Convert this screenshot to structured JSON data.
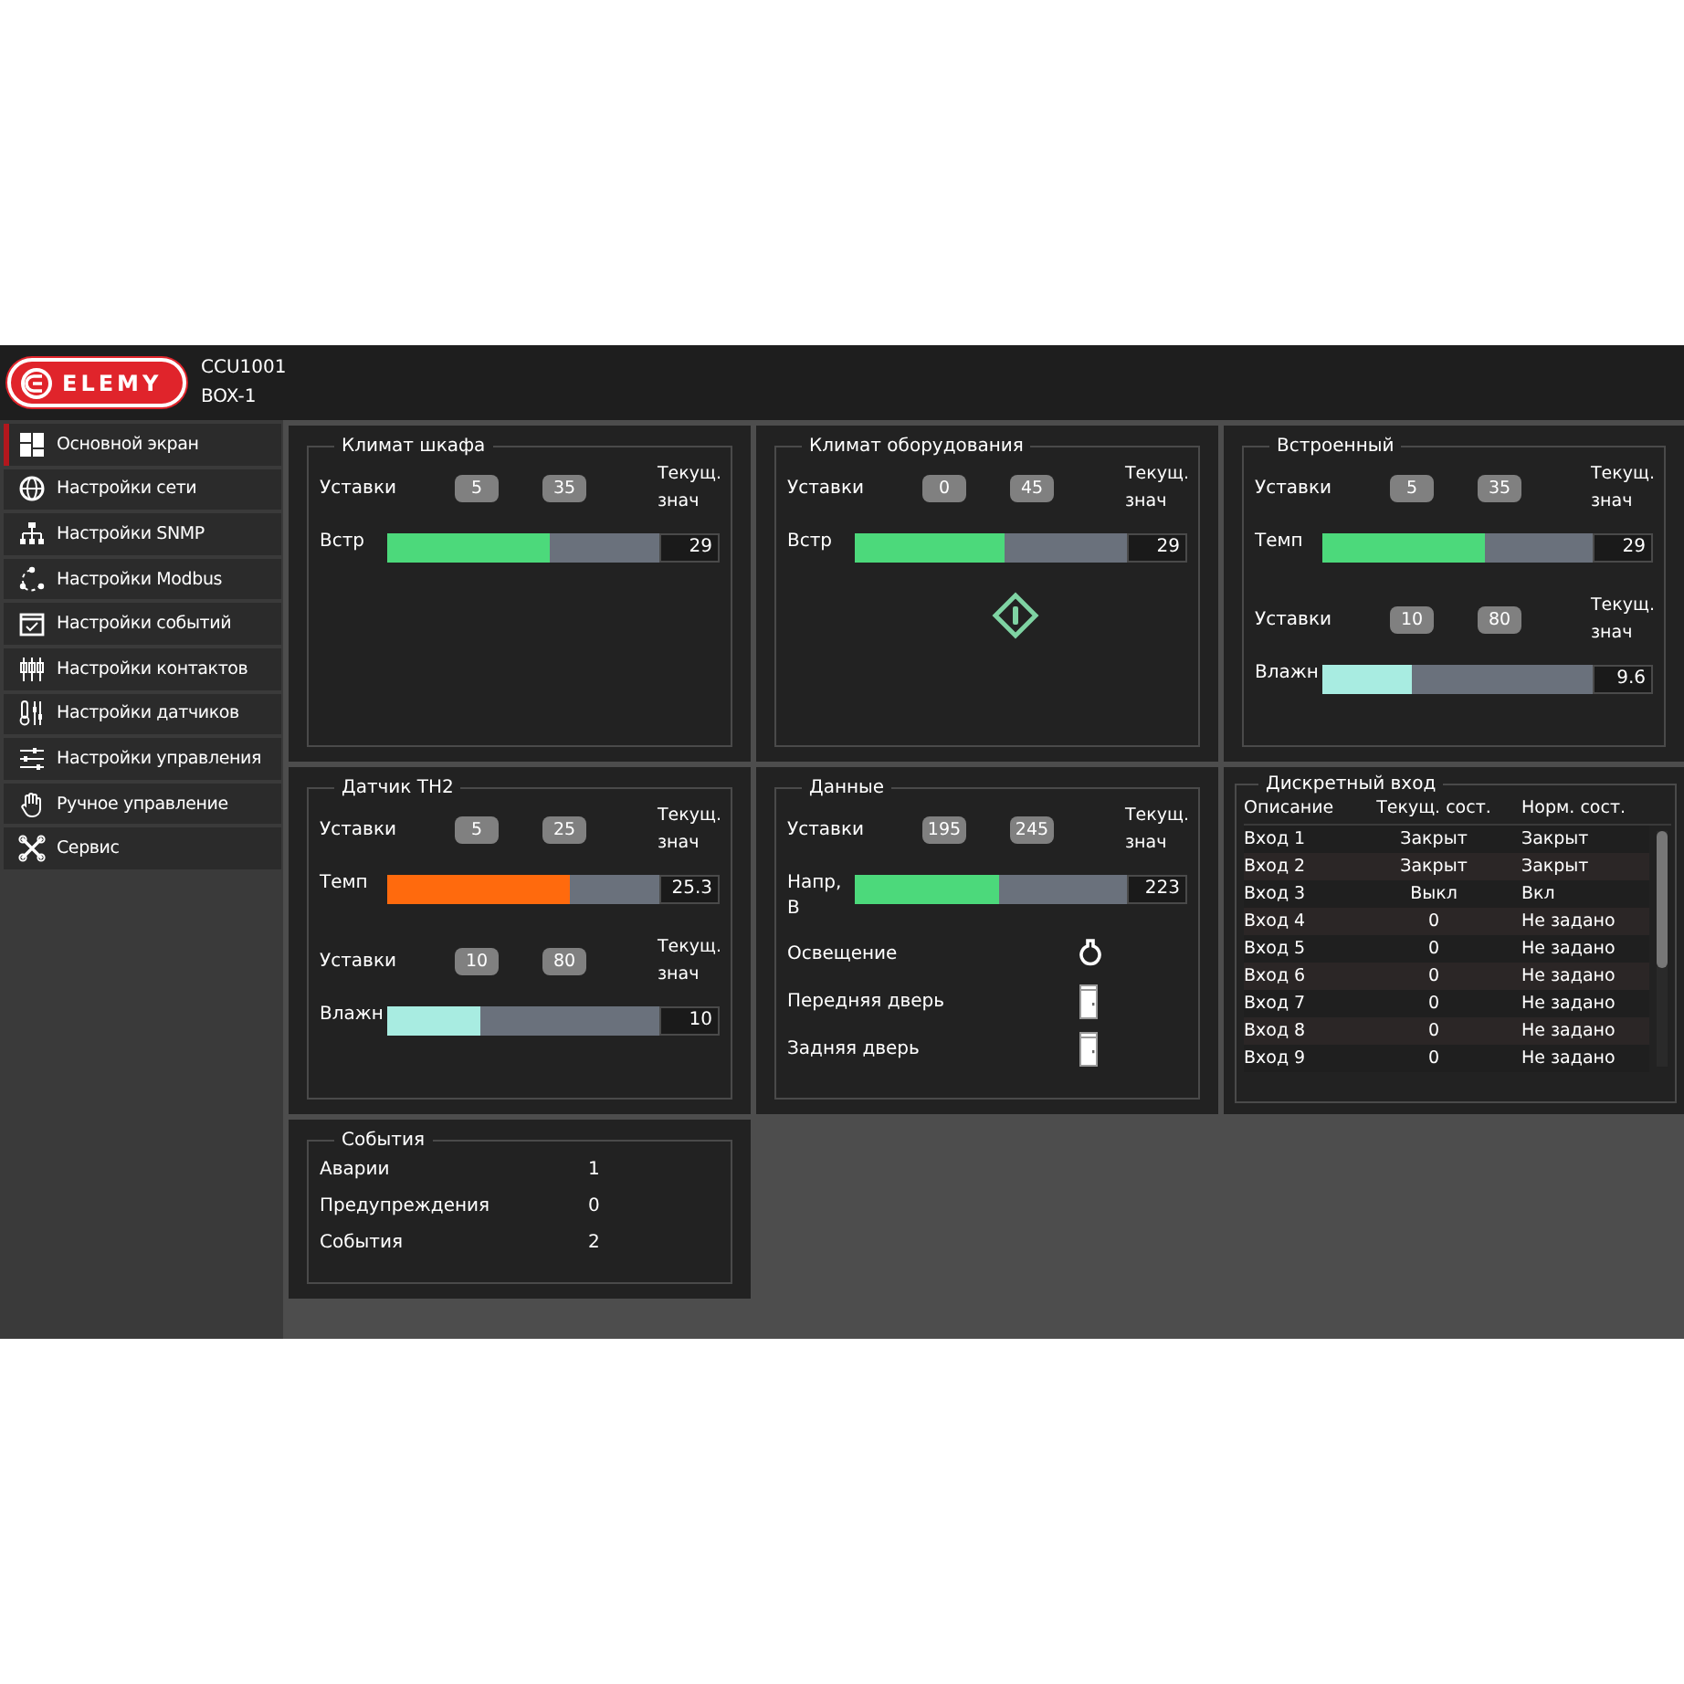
{
  "header": {
    "logo_text": "ELEMY",
    "device": "CCU1001",
    "box": "BOX-1"
  },
  "sidebar": {
    "items": [
      {
        "label": "Основной экран",
        "selected": true
      },
      {
        "label": "Настройки сети",
        "selected": false
      },
      {
        "label": "Настройки SNMP",
        "selected": false
      },
      {
        "label": "Настройки Modbus",
        "selected": false
      },
      {
        "label": "Настройки событий",
        "selected": false
      },
      {
        "label": "Настройки контактов",
        "selected": false
      },
      {
        "label": "Настройки датчиков",
        "selected": false
      },
      {
        "label": "Настройки управления",
        "selected": false
      },
      {
        "label": "Ручное управление",
        "selected": false
      },
      {
        "label": "Сервис",
        "selected": false
      }
    ]
  },
  "panels": [
    {
      "kind": "sensor",
      "title": "Климат шкафа",
      "rows": [
        {
          "kind": "setpoints",
          "label": "Уставки",
          "low": "5",
          "high": "35",
          "note": "Текущ. знач"
        },
        {
          "kind": "bar",
          "label": "Встр",
          "level": 0.6,
          "color": "#4cd97b",
          "value": "29"
        }
      ]
    },
    {
      "kind": "sensor",
      "title": "Климат оборудования",
      "rows": [
        {
          "kind": "setpoints",
          "label": "Уставки",
          "low": "0",
          "high": "45",
          "note": "Текущ. знач"
        },
        {
          "kind": "bar",
          "label": "Встр",
          "level": 0.55,
          "color": "#4cd97b",
          "value": "29"
        },
        {
          "kind": "diamond"
        }
      ]
    },
    {
      "kind": "sensor",
      "title": "Встроенный",
      "rows": [
        {
          "kind": "setpoints",
          "label": "Уставки",
          "low": "5",
          "high": "35",
          "note": "Текущ. знач"
        },
        {
          "kind": "bar",
          "label": "Темп",
          "level": 0.6,
          "color": "#4cd97b",
          "value": "29"
        },
        {
          "kind": "setpoints",
          "label": "Уставки",
          "low": "10",
          "high": "80",
          "note": "Текущ. знач"
        },
        {
          "kind": "bar",
          "label": "Влажн",
          "level": 0.33,
          "color": "#a8ece1",
          "value": "9.6"
        }
      ]
    },
    {
      "kind": "sensor",
      "title": "Датчик TH2",
      "rows": [
        {
          "kind": "setpoints",
          "label": "Уставки",
          "low": "5",
          "high": "25",
          "note": "Текущ. знач"
        },
        {
          "kind": "bar",
          "label": "Темп",
          "level": 0.67,
          "color": "#ff6a0d",
          "value": "25.3"
        },
        {
          "kind": "setpoints",
          "label": "Уставки",
          "low": "10",
          "high": "80",
          "note": "Текущ. знач"
        },
        {
          "kind": "bar",
          "label": "Влажн",
          "level": 0.34,
          "color": "#a8ece1",
          "value": "10"
        }
      ]
    },
    {
      "kind": "sensor",
      "title": "Данные",
      "rows": [
        {
          "kind": "setpoints",
          "label": "Уставки",
          "low": "195",
          "high": "245",
          "note": "Текущ. знач"
        },
        {
          "kind": "bar",
          "label": "Напр, В",
          "level": 0.53,
          "color": "#4cd97b",
          "value": "223"
        },
        {
          "kind": "lamp",
          "label": "Освещение"
        },
        {
          "kind": "door",
          "label": "Передняя дверь"
        },
        {
          "kind": "door",
          "label": "Задняя дверь"
        }
      ]
    },
    {
      "kind": "table",
      "title": "Дискретный вход",
      "columns": [
        "Описание",
        "Текущ. сост.",
        "Норм. сост."
      ],
      "rows": [
        [
          "Вход 1",
          "Закрыт",
          "Закрыт"
        ],
        [
          "Вход 2",
          "Закрыт",
          "Закрыт"
        ],
        [
          "Вход 3",
          "Выкл",
          "Вкл"
        ],
        [
          "Вход 4",
          "0",
          "Не задано"
        ],
        [
          "Вход 5",
          "0",
          "Не задано"
        ],
        [
          "Вход 6",
          "0",
          "Не задано"
        ],
        [
          "Вход 7",
          "0",
          "Не задано"
        ],
        [
          "Вход 8",
          "0",
          "Не задано"
        ],
        [
          "Вход 9",
          "0",
          "Не задано"
        ]
      ]
    },
    {
      "kind": "counts",
      "title": "События",
      "rows": [
        {
          "label": "Аварии",
          "value": "1"
        },
        {
          "label": "Предупреждения",
          "value": "0"
        },
        {
          "label": "События",
          "value": "2"
        }
      ]
    }
  ]
}
